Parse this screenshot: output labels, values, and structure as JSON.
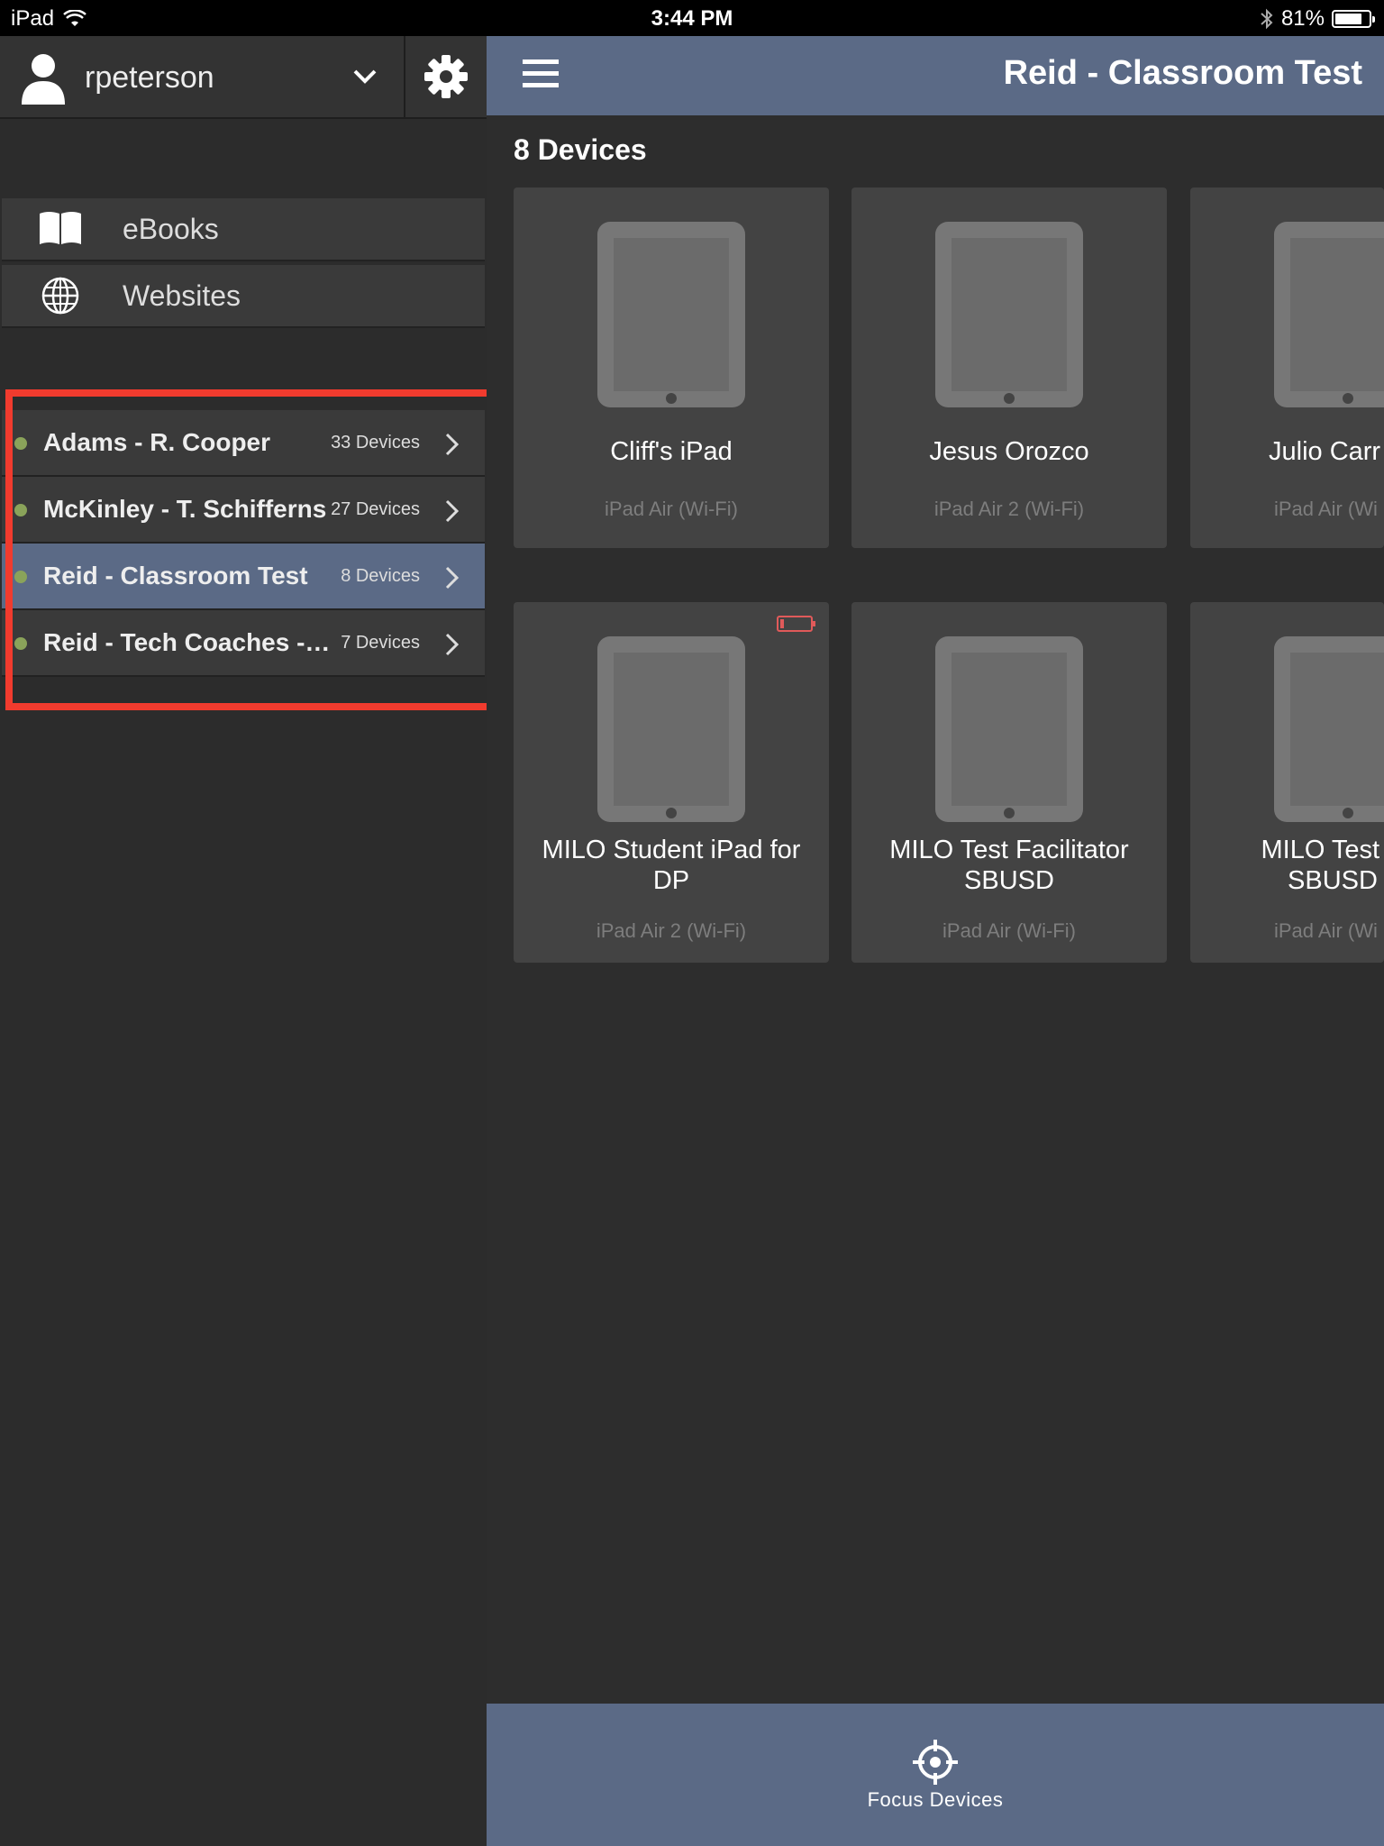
{
  "status_bar": {
    "device": "iPad",
    "time": "3:44 PM",
    "battery": "81%",
    "battery_level": 0.81
  },
  "sidebar": {
    "username": "rpeterson",
    "shelves": [
      {
        "label": "eBooks",
        "icon": "book-icon"
      },
      {
        "label": "Websites",
        "icon": "globe-icon"
      }
    ],
    "classes": [
      {
        "name": "Adams - R. Cooper",
        "count": "33 Devices",
        "active": false
      },
      {
        "name": "McKinley - T. Schifferns",
        "count": "27 Devices",
        "active": false
      },
      {
        "name": "Reid - Classroom Test",
        "count": "8 Devices",
        "active": true
      },
      {
        "name": "Reid - Tech Coaches -…",
        "count": "7 Devices",
        "active": false
      }
    ]
  },
  "main": {
    "title": "Reid - Classroom Test",
    "device_count": "8 Devices",
    "devices": [
      {
        "name": "Cliff's iPad",
        "model": "iPad Air (Wi-Fi)"
      },
      {
        "name": "Jesus Orozco",
        "model": "iPad Air 2 (Wi-Fi)"
      },
      {
        "name": "Julio Carr",
        "model": "iPad Air (Wi"
      },
      {
        "name": "MILO Student iPad for DP",
        "model": "iPad Air 2 (Wi-Fi)",
        "low_battery": true
      },
      {
        "name": "MILO Test Facilitator SBUSD",
        "model": "iPad Air (Wi-Fi)"
      },
      {
        "name": "MILO Test S SBUSD",
        "model": "iPad Air (Wi"
      }
    ]
  },
  "bottom_bar": {
    "focus_label": "Focus Devices"
  },
  "colors": {
    "accent": "#5b6a86",
    "highlight": "#f13b2e",
    "online_dot": "#8aa35a"
  }
}
